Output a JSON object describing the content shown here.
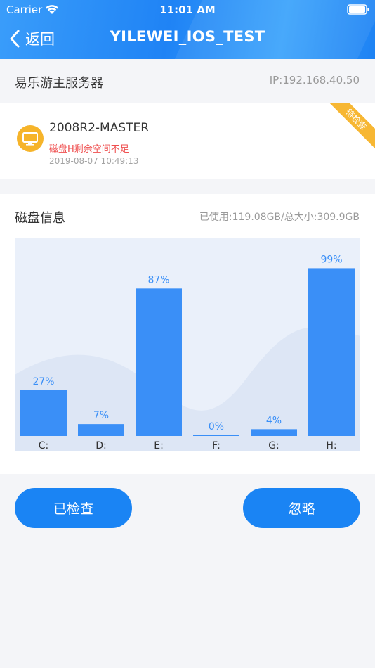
{
  "status_bar": {
    "carrier": "Carrier",
    "time": "11:01 AM"
  },
  "nav": {
    "back_label": "返回",
    "title": "YILEWEI_IOS_TEST"
  },
  "server": {
    "name": "易乐游主服务器",
    "ip": "IP:192.168.40.50"
  },
  "alert": {
    "host": "2008R2-MASTER",
    "message": "磁盘H剩余空间不足",
    "time": "2019-08-07 10:49:13",
    "badge": "待检查",
    "icon": "monitor-icon"
  },
  "disk": {
    "title": "磁盘信息",
    "usage": "已使用:119.08GB/总大小:309.9GB"
  },
  "chart_data": {
    "type": "bar",
    "categories": [
      "C:",
      "D:",
      "E:",
      "F:",
      "G:",
      "H:"
    ],
    "values": [
      27,
      7,
      87,
      0,
      4,
      99
    ],
    "value_labels": [
      "27%",
      "7%",
      "87%",
      "0%",
      "4%",
      "99%"
    ],
    "ylim": [
      0,
      100
    ],
    "bar_color": "#3a8ff7",
    "label_color": "#3a8ff7",
    "grid": false
  },
  "actions": {
    "checked_label": "已检查",
    "ignore_label": "忽略"
  },
  "colors": {
    "accent": "#1a84f4",
    "alert": "#ef4f4f",
    "badge": "#f7b733",
    "device_icon": "#f6b42a"
  }
}
